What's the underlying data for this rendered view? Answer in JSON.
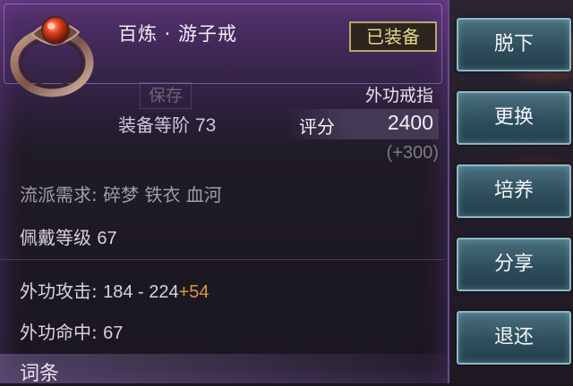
{
  "item": {
    "name": "百炼 · 游子戒",
    "equipped_badge": "已装备",
    "save_label": "保存",
    "type": "外功戒指",
    "tier_label": "装备等阶",
    "tier_value": "73",
    "score_label": "评分",
    "score_value": "2400",
    "score_delta": "(+300)",
    "school_req": "流派需求: 碎梦 铁衣 血河",
    "wear_level_label": "佩戴等级",
    "wear_level_value": "67",
    "attack_label": "外功攻击:",
    "attack_value": "184 - 224",
    "attack_bonus": "+54",
    "hit_label": "外功命中:",
    "hit_value": "67",
    "entries_label": "词条"
  },
  "buttons": {
    "unequip": "脱下",
    "replace": "更换",
    "cultivate": "培养",
    "share": "分享",
    "return": "退还"
  },
  "icons": {
    "ring": "ring-icon"
  },
  "colors": {
    "bonus": "#e0943c",
    "button_border": "#8cb8c6",
    "badge_text": "#e6d68a"
  }
}
